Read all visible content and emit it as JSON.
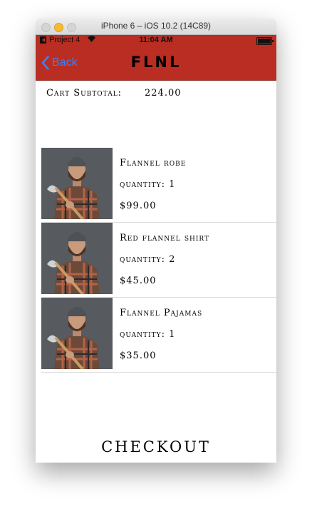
{
  "window": {
    "title": "iPhone 6 – iOS 10.2 (14C89)"
  },
  "status_bar": {
    "carrier": "Project 4",
    "time": "11:04 AM"
  },
  "nav": {
    "back_label": "Back",
    "title": "FLNL"
  },
  "cart": {
    "subtotal_label": "Cart Subtotal:",
    "subtotal_value": "224.00"
  },
  "items": [
    {
      "name": "Flannel robe",
      "quantity": "quantity: 1",
      "price": "$99.00"
    },
    {
      "name": "Red flannel shirt",
      "quantity": "quantity: 2",
      "price": "$45.00"
    },
    {
      "name": "Flannel Pajamas",
      "quantity": "quantity: 1",
      "price": "$35.00"
    }
  ],
  "checkout_label": "CHECKOUT",
  "colors": {
    "nav_red": "#b92d23",
    "ios_blue": "#3d82f7"
  }
}
